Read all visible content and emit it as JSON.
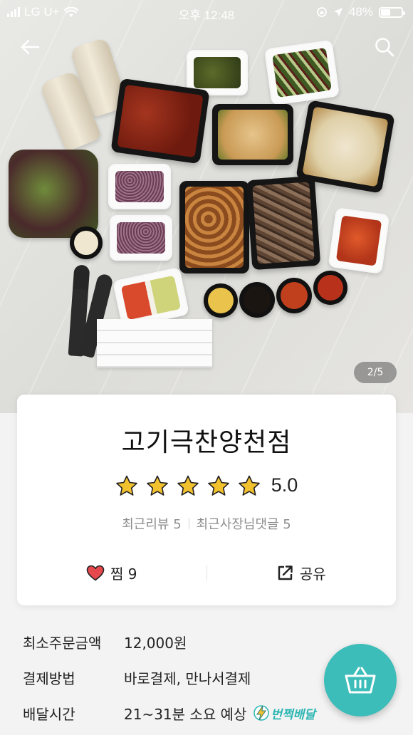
{
  "status_bar": {
    "carrier": "LG U+",
    "time": "오후 12:48",
    "battery_percent": "48%",
    "battery_level": 0.48
  },
  "gallery": {
    "page_indicator": "2/5"
  },
  "store": {
    "name": "고기극찬양천점",
    "rating": 5.0,
    "rating_text": "5.0",
    "stars_filled": 5,
    "recent_reviews": "최근리뷰 5",
    "recent_owner_replies": "최근사장님댓글 5"
  },
  "actions": {
    "favorite_label": "찜 9",
    "share_label": "공유"
  },
  "info": {
    "min_order_label": "최소주문금액",
    "min_order_value": "12,000원",
    "payment_label": "결제방법",
    "payment_value": "바로결제, 만나서결제",
    "delivery_label": "배달시간",
    "delivery_value": "21~31분 소요 예상",
    "badge_text": "번쩍배달"
  },
  "colors": {
    "accent": "#3dbdb9",
    "star": "#f2c12e",
    "heart": "#e5484d"
  },
  "icons": [
    "back-arrow-icon",
    "search-icon",
    "star-icon",
    "heart-icon",
    "share-icon",
    "lightning-icon",
    "cart-basket-icon"
  ]
}
